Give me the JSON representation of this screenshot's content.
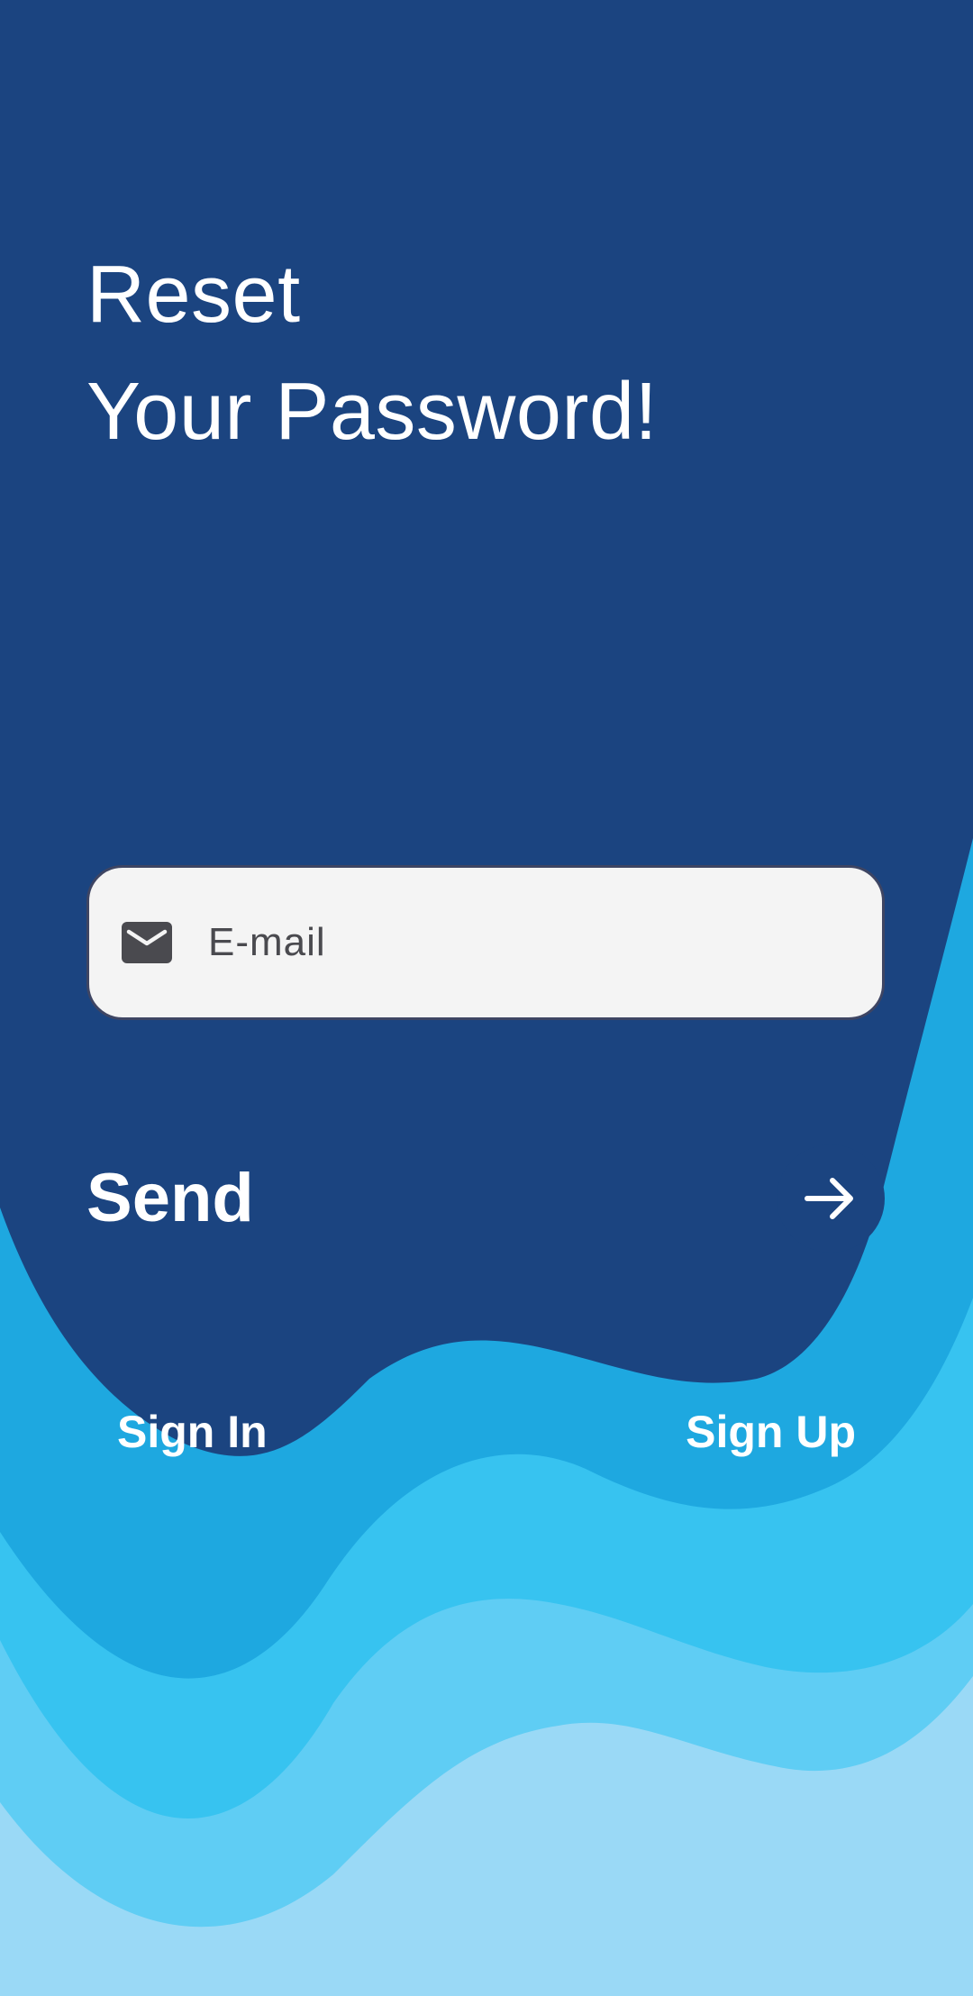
{
  "header": {
    "title_line1": "Reset",
    "title_line2": "Your Password!"
  },
  "email": {
    "placeholder": "E-mail",
    "value": "",
    "icon": "mail-icon"
  },
  "actions": {
    "send_label": "Send",
    "send_icon": "arrow-right-icon",
    "sign_in_label": "Sign In",
    "sign_up_label": "Sign Up"
  },
  "colors": {
    "primary_dark": "#1b4480",
    "wave_1": "#1ea8e0",
    "wave_2": "#37c3f0",
    "wave_3": "#5fcdf4",
    "wave_4": "#9ad9f6",
    "field_background": "#f4f4f4",
    "text_light": "#ffffff"
  }
}
